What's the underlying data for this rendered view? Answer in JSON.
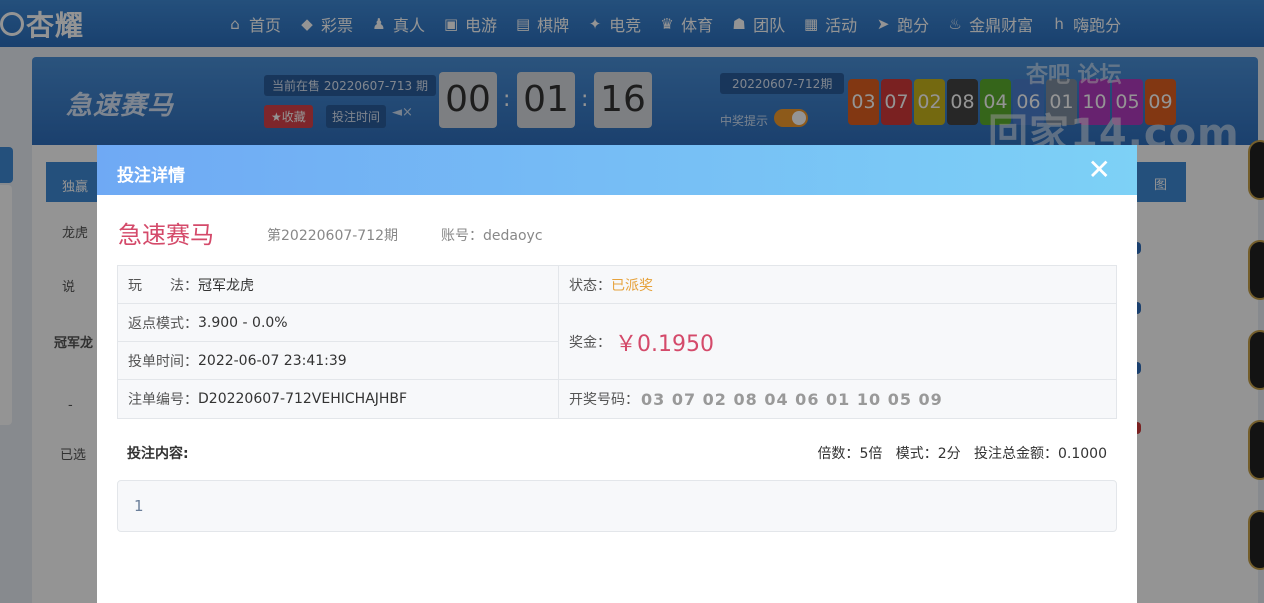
{
  "brand": {
    "name": "杏耀"
  },
  "nav": [
    {
      "icon": "home-icon",
      "glyph": "⌂",
      "label": "首页"
    },
    {
      "icon": "lottery-icon",
      "glyph": "◆",
      "label": "彩票"
    },
    {
      "icon": "live-dealer-icon",
      "glyph": "♟",
      "label": "真人"
    },
    {
      "icon": "slots-icon",
      "glyph": "▣",
      "label": "电游"
    },
    {
      "icon": "cards-icon",
      "glyph": "▤",
      "label": "棋牌"
    },
    {
      "icon": "gamepad-icon",
      "glyph": "✦",
      "label": "电竞"
    },
    {
      "icon": "trophy-icon",
      "glyph": "♛",
      "label": "体育"
    },
    {
      "icon": "team-icon",
      "glyph": "☗",
      "label": "团队"
    },
    {
      "icon": "gift-icon",
      "glyph": "▦",
      "label": "活动"
    },
    {
      "icon": "racing-car-icon",
      "glyph": "➤",
      "label": "跑分"
    },
    {
      "icon": "wealth-icon",
      "glyph": "♨",
      "label": "金鼎财富"
    },
    {
      "icon": "hi-icon",
      "glyph": "h",
      "label": "嗨跑分"
    }
  ],
  "game_header": {
    "game_logo_text": "急速赛马",
    "on_sale_text": "当前在售 20220607-713 期",
    "favorite_label": "★收藏",
    "bet_time_label": "投注时间",
    "mute_glyph": "◄×",
    "countdown": {
      "hours": "00",
      "minutes": "01",
      "seconds": "16"
    },
    "previous_issue": "20220607-712期",
    "win_hint_label": "中奖提示",
    "win_hint_on": true,
    "result_balls": [
      "03",
      "07",
      "02",
      "08",
      "04",
      "06",
      "01",
      "10",
      "05",
      "09"
    ],
    "ball_colors": [
      "#e0601f",
      "#d23a3a",
      "#c9b51c",
      "#444444",
      "#5cae2e",
      "#4a7fcf",
      "#7f8ea1",
      "#b23bbf",
      "#b23bbf",
      "#e0601f"
    ]
  },
  "watermark": {
    "line1": "杏吧  论坛",
    "line2": "回家14.com"
  },
  "background": {
    "tab_label": "独赢",
    "row_dragon_tiger": "龙虎",
    "explain": "说",
    "champion_row": "冠军龙",
    "minus": "-",
    "selected": "已选",
    "right_tool": "图"
  },
  "modal": {
    "title": "投注详情",
    "close_glyph": "✕",
    "game_title": "急速赛马",
    "issue": "第20220607-712期",
    "account_label": "账号：",
    "account": "dedaoyc",
    "play_label": "玩　　法：",
    "play_value": "冠军龙虎",
    "status_label": "状态：",
    "status_value": "已派奖",
    "rebate_label": "返点模式：",
    "rebate_value": "3.900 - 0.0%",
    "bet_time_label": "投单时间：",
    "bet_time_value": "2022-06-07 23:41:39",
    "prize_label": "奖金：",
    "prize_value": "￥0.1950",
    "order_label": "注单编号：",
    "order_value": "D20220607-712VEHICHAJHBF",
    "draw_label": "开奖号码：",
    "draw_value": "03 07 02 08 04 06 01 10 05 09",
    "content_label": "投注内容:",
    "multiplier_label": "倍数：",
    "multiplier_value": "5倍",
    "mode_label": "模式：",
    "mode_value": "2分",
    "total_label": "投注总金额：",
    "total_value": "0.1000",
    "content_value": "1"
  }
}
